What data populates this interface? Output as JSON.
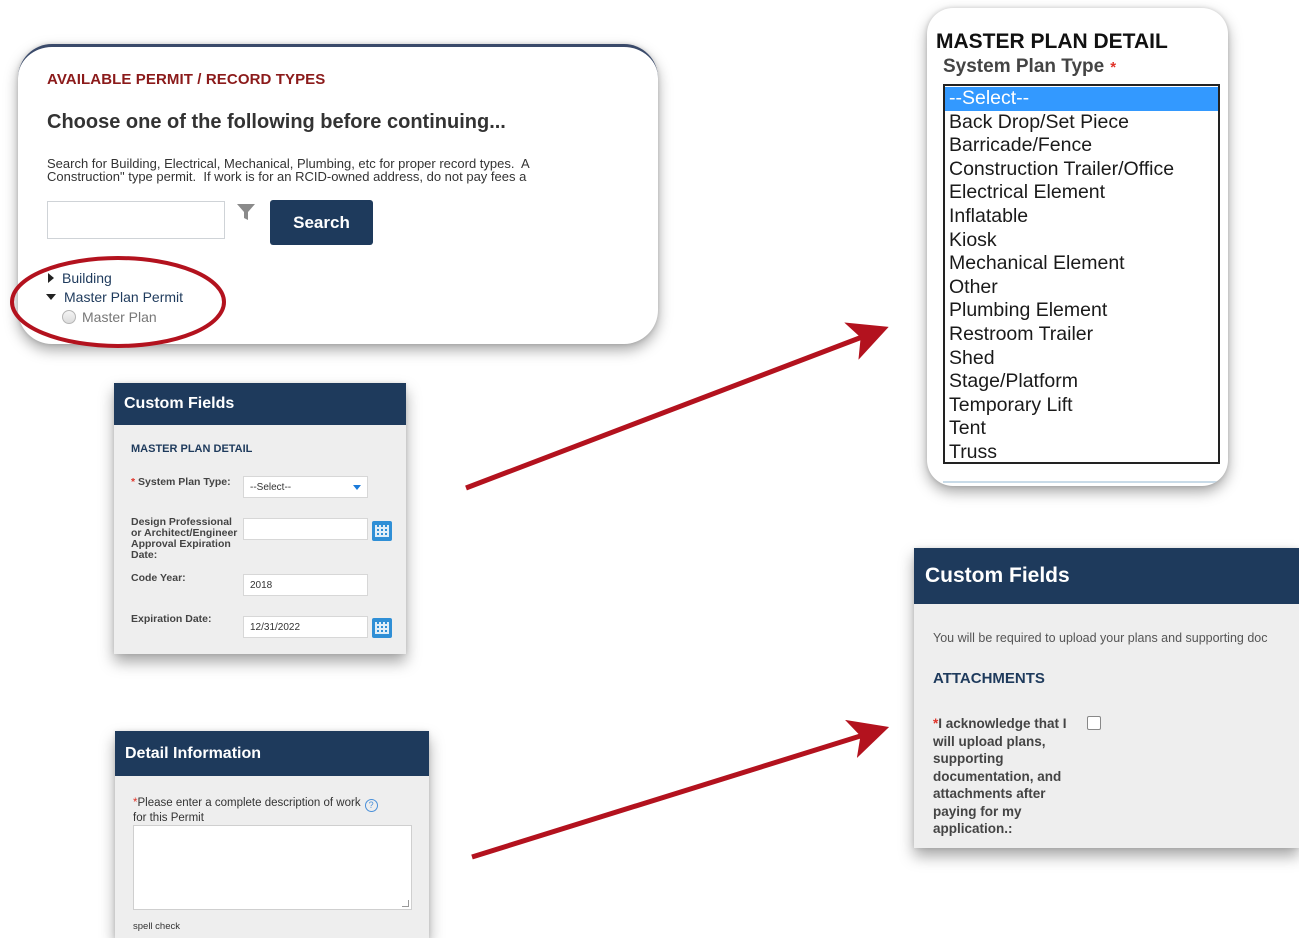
{
  "permit_panel": {
    "heading": "AVAILABLE PERMIT / RECORD TYPES",
    "subheading": "Choose one of the following before continuing...",
    "description_line1": "Search for Building, Electrical, Mechanical, Plumbing, etc for proper record types.  A",
    "description_line2": "Construction\" type permit.  If work is for an RCID-owned address, do not pay fees a",
    "search_placeholder": "",
    "filter_icon": "filter-icon",
    "search_button": "Search",
    "tree": [
      {
        "label": "Building",
        "expanded": false
      },
      {
        "label": "Master Plan Permit",
        "expanded": true
      }
    ],
    "radio_option": "Master Plan",
    "highlight_color": "#b3121e"
  },
  "select_panel": {
    "heading": "MASTER PLAN DETAIL",
    "label": "System Plan Type",
    "required_mark": "*",
    "options": [
      "--Select--",
      "Back Drop/Set Piece",
      "Barricade/Fence",
      "Construction Trailer/Office",
      "Electrical Element",
      "Inflatable",
      "Kiosk",
      "Mechanical Element",
      "Other",
      "Plumbing Element",
      "Restroom Trailer",
      "Shed",
      "Stage/Platform",
      "Temporary Lift",
      "Tent",
      "Truss"
    ],
    "selected_index": 0
  },
  "custom_fields_small": {
    "title": "Custom Fields",
    "section": "MASTER PLAN DETAIL",
    "fields": [
      {
        "label": "System Plan Type:",
        "required": true,
        "value": "--Select--"
      },
      {
        "label": "Design Professional or Architect/Engineer Approval Expiration Date:",
        "required": false,
        "value": ""
      },
      {
        "label": "Code Year:",
        "required": false,
        "value": "2018"
      },
      {
        "label": "Expiration Date:",
        "required": false,
        "value": "12/31/2022"
      }
    ],
    "label_lines": [
      "Design Professional",
      "or Architect/Engineer",
      "Approval Expiration",
      "Date:"
    ]
  },
  "custom_fields_attachments": {
    "title": "Custom Fields",
    "note": "You will be required to upload your plans and supporting doc",
    "section": "ATTACHMENTS",
    "ack_lines": [
      "I acknowledge that I",
      "will upload plans,",
      "supporting",
      "documentation, and",
      "attachments after",
      "paying for my",
      "application.:"
    ]
  },
  "detail_panel": {
    "title": "Detail Information",
    "label_line1": "Please enter a complete description of work",
    "label_line2": "for this Permit",
    "help_icon": "?",
    "spell_check": "spell check"
  },
  "colors": {
    "header_navy": "#1e3a5c",
    "arrow_red": "#b3121e",
    "required_red": "#e0342a",
    "select_blue": "#3399ff"
  }
}
